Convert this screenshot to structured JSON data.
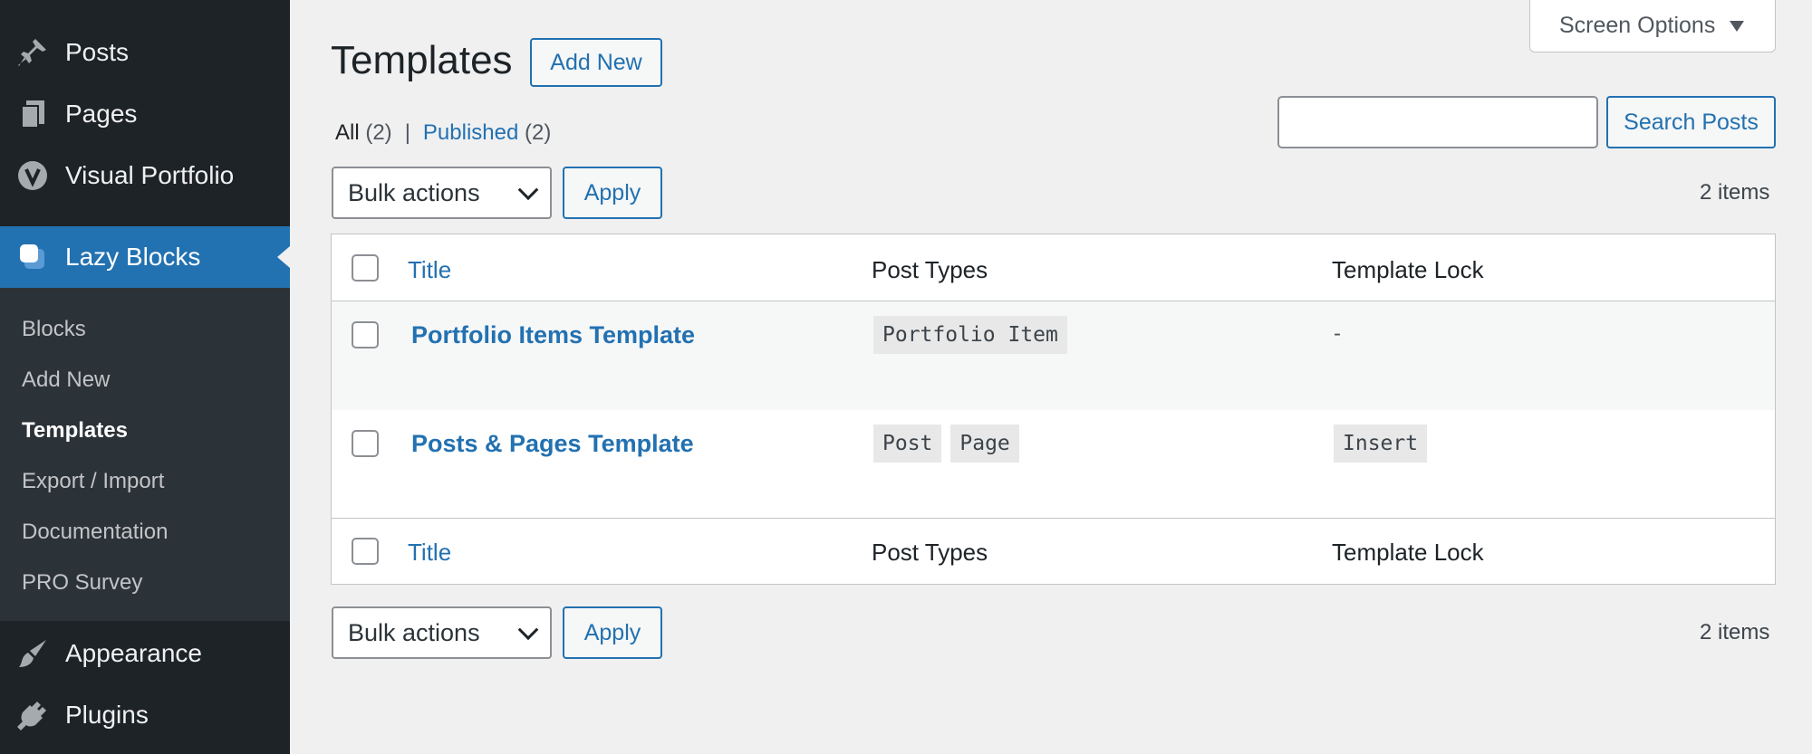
{
  "sidebar": {
    "items": [
      {
        "label": "Posts",
        "icon": "pin-icon"
      },
      {
        "label": "Pages",
        "icon": "pages-icon"
      },
      {
        "label": "Visual Portfolio",
        "icon": "v-logo-icon"
      },
      {
        "label": "Lazy Blocks",
        "icon": "lazy-blocks-icon"
      },
      {
        "label": "Appearance",
        "icon": "brush-icon"
      },
      {
        "label": "Plugins",
        "icon": "plug-icon"
      }
    ],
    "submenu": [
      "Blocks",
      "Add New",
      "Templates",
      "Export / Import",
      "Documentation",
      "PRO Survey"
    ]
  },
  "header": {
    "title": "Templates",
    "add_new": "Add New",
    "screen_options": "Screen Options"
  },
  "filters": {
    "all_label": "All",
    "all_count": "(2)",
    "separator": "|",
    "published_label": "Published",
    "published_count": "(2)"
  },
  "search": {
    "button": "Search Posts",
    "value": ""
  },
  "bulk": {
    "select": "Bulk actions",
    "apply": "Apply",
    "items_count": "2 items"
  },
  "table": {
    "columns": [
      "Title",
      "Post Types",
      "Template Lock"
    ],
    "rows": [
      {
        "title": "Portfolio Items Template",
        "post_types": [
          "Portfolio Item"
        ],
        "lock": "-"
      },
      {
        "title": "Posts & Pages Template",
        "post_types": [
          "Post",
          "Page"
        ],
        "lock": "Insert"
      }
    ]
  },
  "colors": {
    "sidebar_bg": "#1d2327",
    "submenu_bg": "#2c3338",
    "accent": "#2271b1",
    "page_bg": "#f0f0f1"
  }
}
